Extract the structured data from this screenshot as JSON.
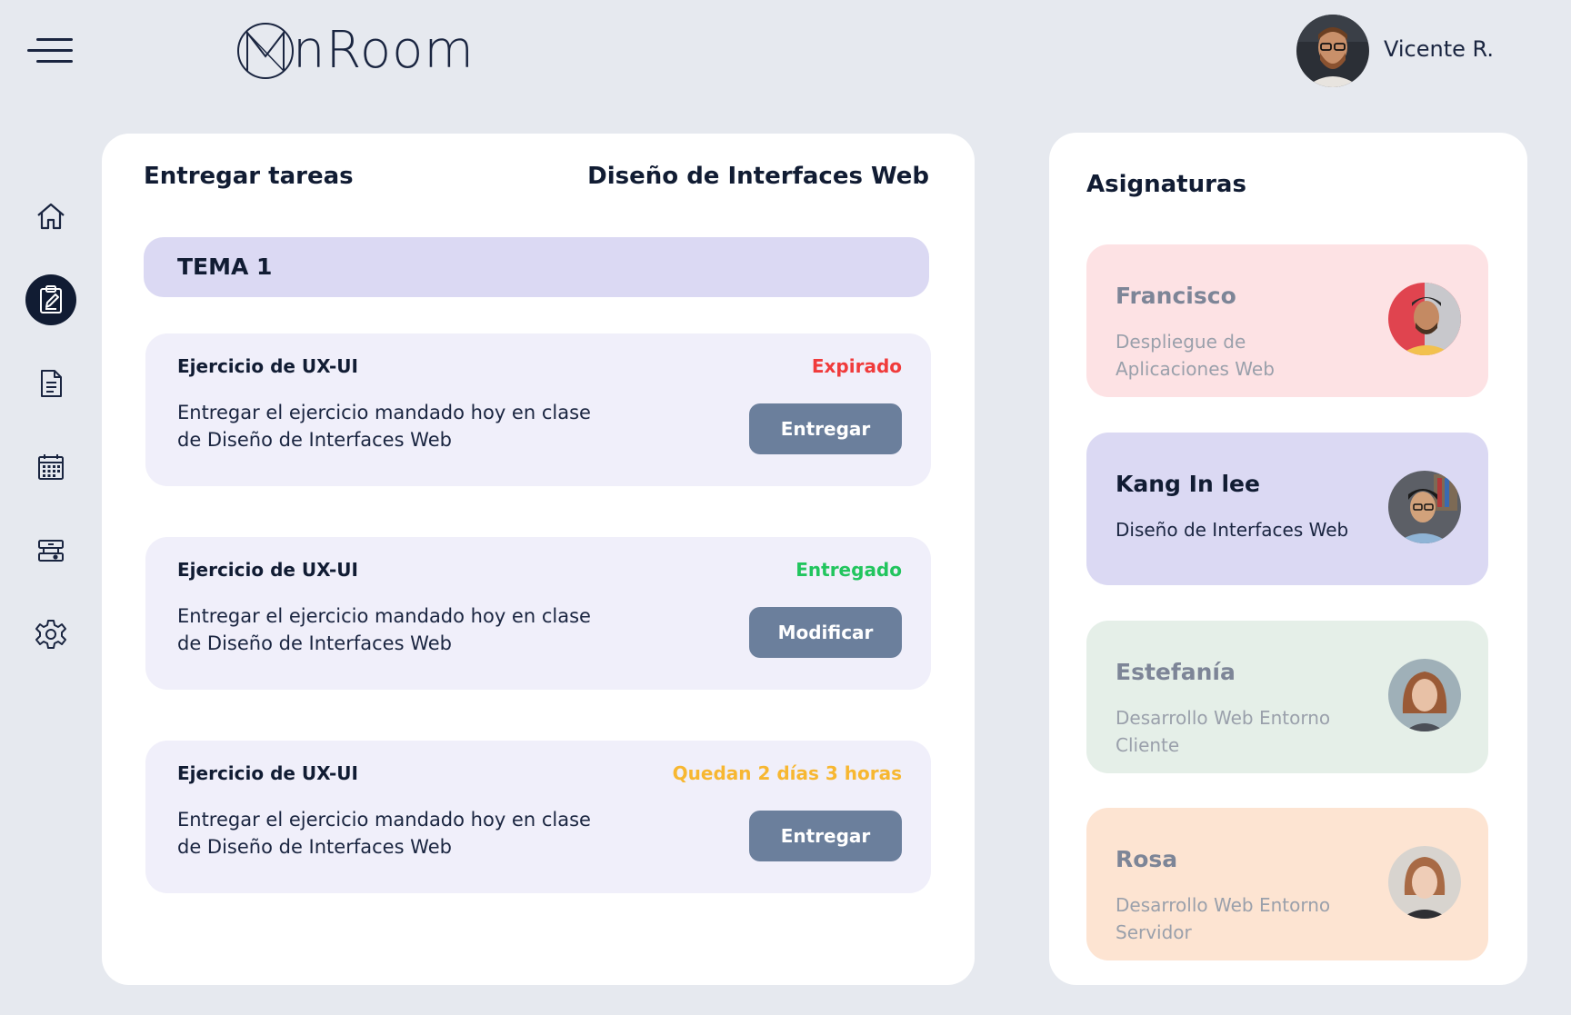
{
  "header": {
    "logo_text": "nRoom",
    "user_name": "Vicente R."
  },
  "sidebar": {
    "items": [
      {
        "name": "home",
        "icon": "home-icon"
      },
      {
        "name": "tasks",
        "icon": "clipboard-edit-icon",
        "active": true
      },
      {
        "name": "documents",
        "icon": "document-icon"
      },
      {
        "name": "calendar",
        "icon": "calendar-icon"
      },
      {
        "name": "resources",
        "icon": "board-icon"
      },
      {
        "name": "settings",
        "icon": "gear-icon"
      }
    ]
  },
  "main": {
    "title": "Entregar tareas",
    "course": "Diseño de Interfaces Web",
    "section": "TEMA 1",
    "tasks": [
      {
        "title": "Ejercicio de UX-UI",
        "status": "Expirado",
        "status_color": "#f03b3b",
        "description": "Entregar el ejercicio mandado hoy en clase de Diseño de Interfaces Web",
        "button": "Entregar"
      },
      {
        "title": "Ejercicio de UX-UI",
        "status": "Entregado",
        "status_color": "#22c55e",
        "description": "Entregar el ejercicio mandado hoy en clase de Diseño de Interfaces Web",
        "button": "Modificar"
      },
      {
        "title": "Ejercicio de UX-UI",
        "status": "Quedan 2 días 3 horas",
        "status_color": "#f7b731",
        "description": "Entregar el ejercicio mandado hoy en clase de Diseño de Interfaces Web",
        "button": "Entregar"
      }
    ]
  },
  "subjects": {
    "title": "Asignaturas",
    "items": [
      {
        "teacher": "Francisco",
        "course": "Despliegue de Aplicaciones Web",
        "bg": "#fde2e4",
        "active": false
      },
      {
        "teacher": "Kang In lee",
        "course": "Diseño de Interfaces Web",
        "bg": "#dbd9f3",
        "active": true
      },
      {
        "teacher": "Estefanía",
        "course": "Desarrollo Web Entorno Cliente",
        "bg": "#e5efe8",
        "active": false
      },
      {
        "teacher": "Rosa",
        "course": "Desarrollo Web Entorno Servidor",
        "bg": "#fde4d2",
        "active": false
      }
    ]
  },
  "colors": {
    "background": "#e6e9ef",
    "dark": "#111c33",
    "button": "#6b7f9c"
  }
}
